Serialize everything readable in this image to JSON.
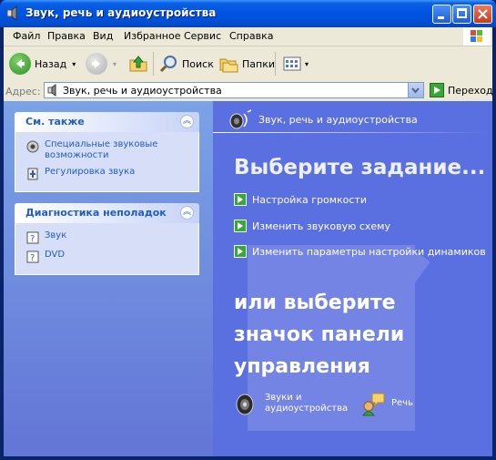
{
  "window": {
    "title": "Звук, речь и аудиоустройства"
  },
  "menu": {
    "items": [
      "Файл",
      "Правка",
      "Вид",
      "Избранное",
      "Сервис",
      "Справка"
    ]
  },
  "toolbar": {
    "back": "Назад",
    "search": "Поиск",
    "folders": "Папки"
  },
  "address": {
    "label": "Адрес:",
    "value": "Звук, речь и аудиоустройства",
    "go": "Переход"
  },
  "see_also": {
    "title": "См. также",
    "links": [
      "Специальные звуковые возможности",
      "Регулировка звука"
    ]
  },
  "troubleshoot": {
    "title": "Диагностика неполадок",
    "links": [
      "Звук",
      "DVD"
    ]
  },
  "right": {
    "header": "Звук, речь и аудиоустройства",
    "choose_task": "Выберите задание...",
    "tasks": [
      "Настройка громкости",
      "Изменить звуковую схему",
      "Изменить параметры настройки динамиков"
    ],
    "or_pick": "или выберите значок панели управления",
    "icons": [
      {
        "label": "Звуки и аудиоустройства",
        "icon": "speaker-icon"
      },
      {
        "label": "Речь",
        "icon": "speech-icon"
      }
    ]
  },
  "colors": {
    "title_bar": "#0054e3",
    "task_pane": "#6375d6",
    "right_pane": "#5a6fe0",
    "link": "#215dc6"
  }
}
